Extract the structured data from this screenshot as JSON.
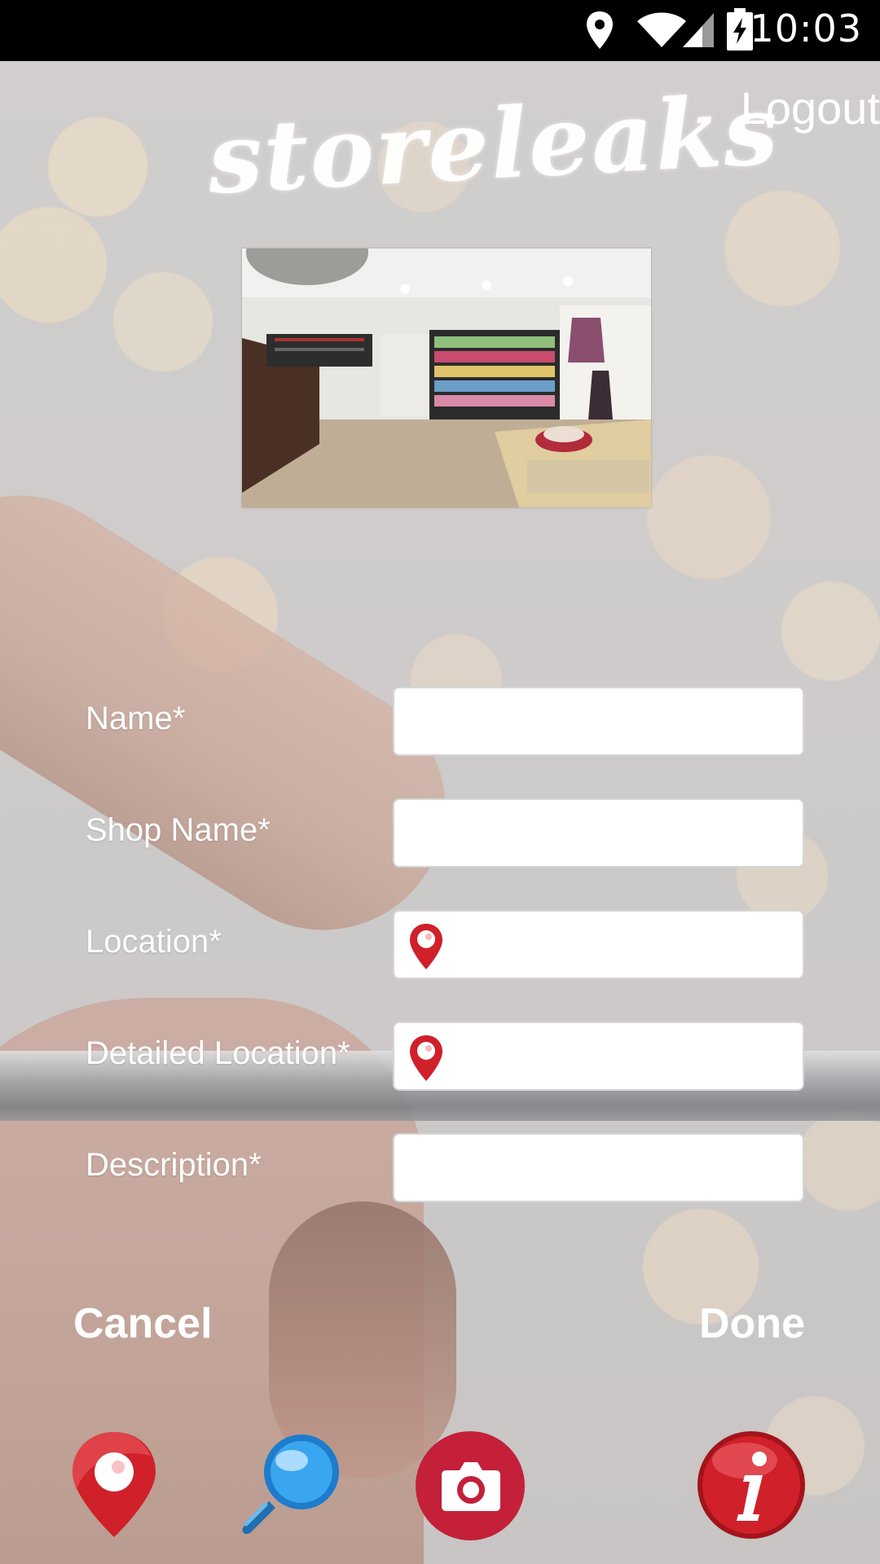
{
  "status_bar": {
    "time": "10:03",
    "icons": [
      "location-icon",
      "wifi-icon",
      "signal-icon",
      "battery-charging-icon"
    ]
  },
  "header": {
    "logo": "storeleaks",
    "logout_label": "Logout"
  },
  "form": {
    "fields": [
      {
        "label": "Name*",
        "value": "",
        "placeholder": "",
        "icon": null
      },
      {
        "label": "Shop Name*",
        "value": "",
        "placeholder": "",
        "icon": null
      },
      {
        "label": "Location*",
        "value": "",
        "placeholder": "",
        "icon": "map-pin-icon"
      },
      {
        "label": "Detailed Location*",
        "value": "",
        "placeholder": "",
        "icon": "map-pin-icon"
      },
      {
        "label": "Description*",
        "value": "",
        "placeholder": "",
        "icon": null
      }
    ]
  },
  "actions": {
    "cancel_label": "Cancel",
    "done_label": "Done"
  },
  "bottom_nav": {
    "icons": [
      "map-marker-icon",
      "magnifier-icon",
      "camera-icon",
      "info-icon"
    ]
  },
  "colors": {
    "accent_red": "#d0202a",
    "camera_red": "#c4203a",
    "search_blue": "#2a8fd8",
    "status_bar_bg": "#000000",
    "label_text": "#ffffff"
  }
}
